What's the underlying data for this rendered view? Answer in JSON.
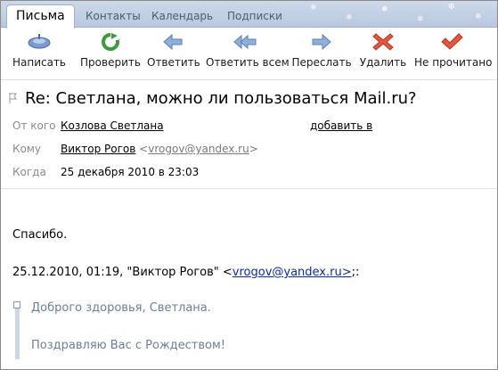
{
  "tabs": [
    {
      "label": "Письма",
      "active": true
    },
    {
      "label": "Контакты",
      "active": false
    },
    {
      "label": "Календарь",
      "active": false
    },
    {
      "label": "Подписки",
      "active": false
    }
  ],
  "toolbar": {
    "compose": {
      "label": "Написать",
      "icon": "compose-icon"
    },
    "check": {
      "label": "Проверить",
      "icon": "refresh-icon"
    },
    "reply": {
      "label": "Ответить",
      "icon": "reply-arrow-icon"
    },
    "reply_all": {
      "label": "Ответить всем",
      "icon": "reply-all-icon"
    },
    "forward": {
      "label": "Переслать",
      "icon": "forward-arrow-icon"
    },
    "delete": {
      "label": "Удалить",
      "icon": "delete-x-icon"
    },
    "mark_unread": {
      "label": "Не прочитано",
      "icon": "checkmark-icon"
    }
  },
  "message": {
    "subject": "Re: Светлана, можно ли пользоваться Mail.ru?",
    "from_label": "От кого",
    "from_value": "Козлова Светлана",
    "add_to": "добавить в",
    "to_label": "Кому",
    "to_name": "Виктор Рогов",
    "to_email_open": "<",
    "to_email": "vrogov@yandex.ru",
    "to_email_close": ">",
    "date_label": "Когда",
    "date_value": "25 декабря 2010 в 23:03"
  },
  "body": {
    "line1": "Спасибо.",
    "quote_header_prefix": "25.12.2010, 01:19, \"Виктор Рогов\" <",
    "quote_header_email": "vrogov@yandex.ru>",
    "quote_header_suffix": ";:",
    "quote_line1": "Доброго здоровья, Светлана.",
    "quote_line2": "Поздравляю Вас с Рождеством!"
  },
  "colors": {
    "tabbar_bg": "#c3d1e5",
    "link": "#0a2aa8",
    "quote_text": "#6a7f98",
    "delete_red": "#d6452f",
    "check_green": "#3c9a3a"
  }
}
